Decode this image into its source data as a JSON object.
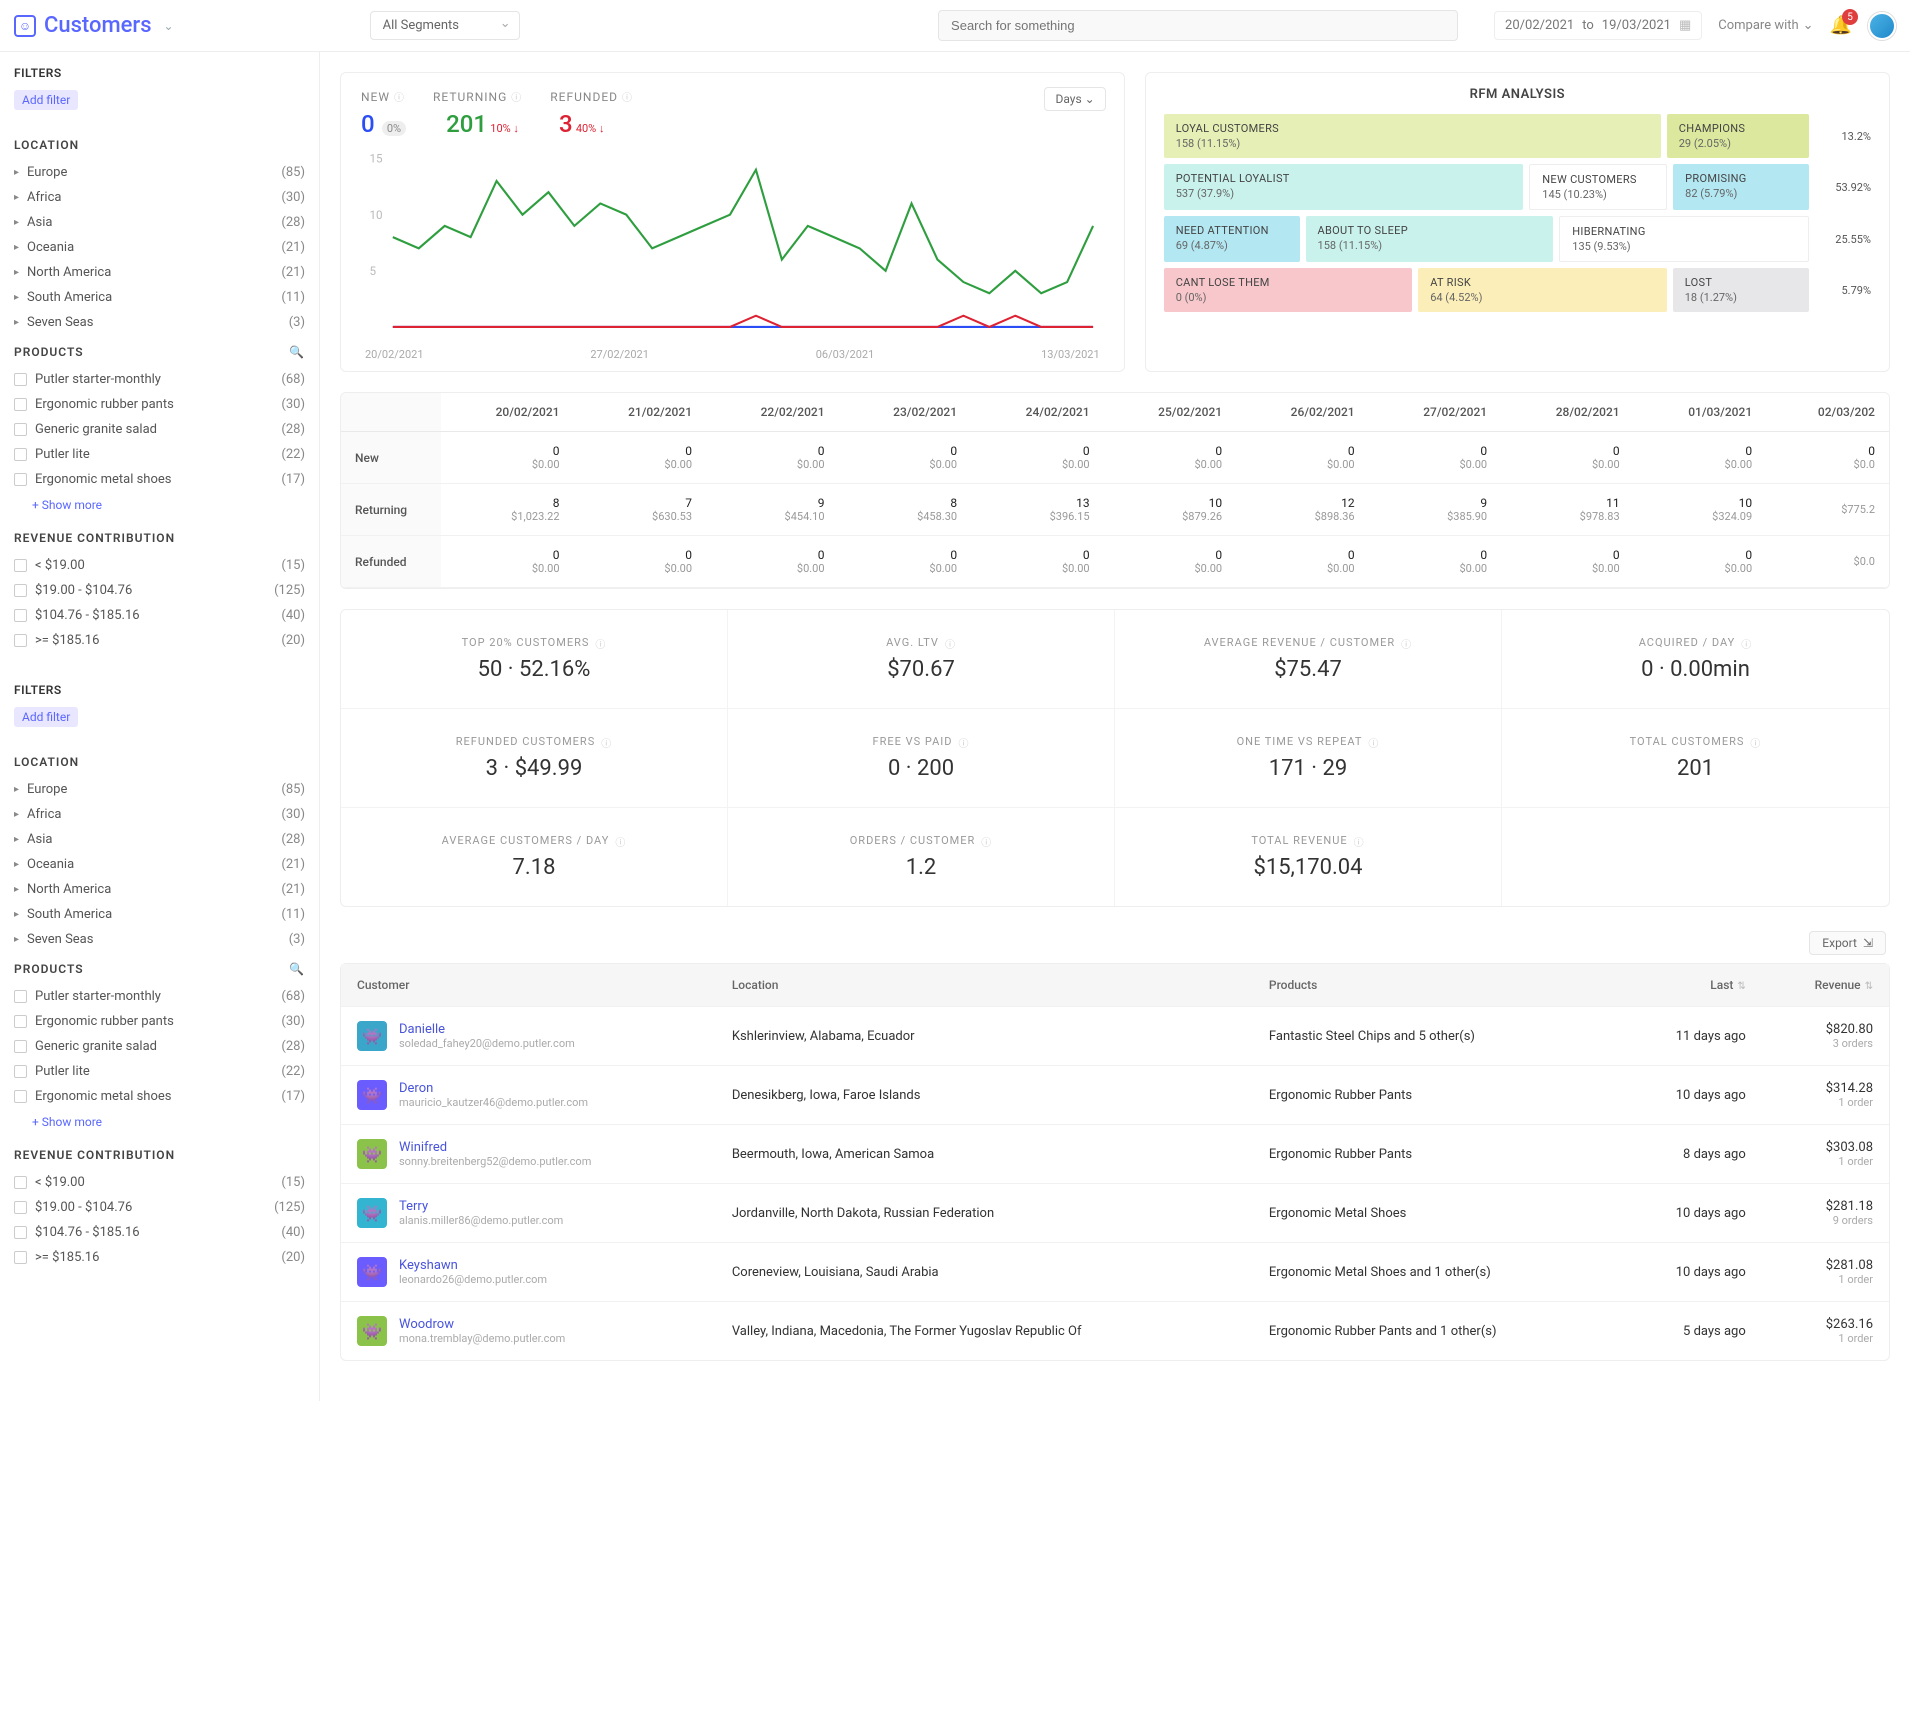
{
  "header": {
    "title": "Customers",
    "segment": "All Segments",
    "search_placeholder": "Search for something",
    "date_from": "20/02/2021",
    "date_to": "19/03/2021",
    "to": "to",
    "compare": "Compare with",
    "notif_count": "5"
  },
  "sidebar": {
    "filters_label": "FILTERS",
    "add_filter": "Add filter",
    "location_label": "LOCATION",
    "products_label": "PRODUCTS",
    "revenue_label": "REVENUE CONTRIBUTION",
    "show_more": "+ Show more",
    "locations": [
      {
        "name": "Europe",
        "count": "85"
      },
      {
        "name": "Africa",
        "count": "30"
      },
      {
        "name": "Asia",
        "count": "28"
      },
      {
        "name": "Oceania",
        "count": "21"
      },
      {
        "name": "North America",
        "count": "21"
      },
      {
        "name": "South America",
        "count": "11"
      },
      {
        "name": "Seven Seas",
        "count": "3"
      }
    ],
    "products": [
      {
        "name": "Putler starter-monthly",
        "count": "68"
      },
      {
        "name": "Ergonomic rubber pants",
        "count": "30"
      },
      {
        "name": "Generic granite salad",
        "count": "28"
      },
      {
        "name": "Putler lite",
        "count": "22"
      },
      {
        "name": "Ergonomic metal shoes",
        "count": "17"
      }
    ],
    "revenue": [
      {
        "name": "< $19.00",
        "count": "15"
      },
      {
        "name": "$19.00 - $104.76",
        "count": "125"
      },
      {
        "name": "$104.76 - $185.16",
        "count": "40"
      },
      {
        "name": ">= $185.16",
        "count": "20"
      }
    ]
  },
  "trend": {
    "tabs": {
      "new": "NEW",
      "returning": "RETURNING",
      "refunded": "REFUNDED"
    },
    "new_val": "0",
    "new_pct": "0%",
    "ret_val": "201",
    "ret_pct": "10% ↓",
    "ref_val": "3",
    "ref_pct": "40% ↓",
    "days": "Days",
    "y_ticks": [
      "15",
      "10",
      "5"
    ],
    "x_ticks": [
      "20/02/2021",
      "27/02/2021",
      "06/03/2021",
      "13/03/2021"
    ]
  },
  "chart_data": {
    "type": "line",
    "title": "",
    "xlabel": "",
    "ylabel": "",
    "ylim": [
      0,
      15
    ],
    "categories": [
      "20/02",
      "21/02",
      "22/02",
      "23/02",
      "24/02",
      "25/02",
      "26/02",
      "27/02",
      "28/02",
      "01/03",
      "02/03",
      "03/03",
      "04/03",
      "05/03",
      "06/03",
      "07/03",
      "08/03",
      "09/03",
      "10/03",
      "11/03",
      "12/03",
      "13/03",
      "14/03",
      "15/03",
      "16/03",
      "17/03",
      "18/03",
      "19/03"
    ],
    "series": [
      {
        "name": "New",
        "color": "#2a4df5",
        "values": [
          0,
          0,
          0,
          0,
          0,
          0,
          0,
          0,
          0,
          0,
          0,
          0,
          0,
          0,
          0,
          0,
          0,
          0,
          0,
          0,
          0,
          0,
          0,
          0,
          0,
          0,
          0,
          0
        ]
      },
      {
        "name": "Returning",
        "color": "#2e9e3f",
        "values": [
          8,
          7,
          9,
          8,
          13,
          10,
          12,
          9,
          11,
          10,
          7,
          8,
          9,
          10,
          14,
          6,
          9,
          8,
          7,
          5,
          11,
          6,
          4,
          3,
          5,
          3,
          4,
          9
        ]
      },
      {
        "name": "Refunded",
        "color": "#d23",
        "values": [
          0,
          0,
          0,
          0,
          0,
          0,
          0,
          0,
          0,
          0,
          0,
          0,
          0,
          0,
          1,
          0,
          0,
          0,
          0,
          0,
          0,
          0,
          1,
          0,
          1,
          0,
          0,
          0
        ]
      }
    ]
  },
  "rfm": {
    "title": "RFM ANALYSIS",
    "rows": [
      {
        "cells": [
          {
            "cls": "c-loyal",
            "t": "LOYAL CUSTOMERS",
            "n": "158 (11.15%)"
          },
          {
            "cls": "c-champ",
            "t": "CHAMPIONS",
            "n": "29 (2.05%)"
          }
        ],
        "pct": "13.2%"
      },
      {
        "cells": [
          {
            "cls": "c-potential",
            "t": "POTENTIAL LOYALIST",
            "n": "537 (37.9%)"
          },
          {
            "cls": "c-newc",
            "t": "NEW CUSTOMERS",
            "n": "145 (10.23%)"
          },
          {
            "cls": "c-prom",
            "t": "PROMISING",
            "n": "82 (5.79%)"
          }
        ],
        "pct": "53.92%"
      },
      {
        "cells": [
          {
            "cls": "c-need",
            "t": "NEED ATTENTION",
            "n": "69 (4.87%)"
          },
          {
            "cls": "c-sleep",
            "t": "ABOUT TO SLEEP",
            "n": "158 (11.15%)"
          },
          {
            "cls": "c-hib",
            "t": "HIBERNATING",
            "n": "135 (9.53%)"
          }
        ],
        "pct": "25.55%"
      },
      {
        "cells": [
          {
            "cls": "c-cant",
            "t": "CANT LOSE THEM",
            "n": "0 (0%)"
          },
          {
            "cls": "c-risk",
            "t": "AT RISK",
            "n": "64 (4.52%)"
          },
          {
            "cls": "c-lost",
            "t": "LOST",
            "n": "18 (1.27%)"
          }
        ],
        "pct": "5.79%"
      }
    ]
  },
  "daily": {
    "dates": [
      "20/02/2021",
      "21/02/2021",
      "22/02/2021",
      "23/02/2021",
      "24/02/2021",
      "25/02/2021",
      "26/02/2021",
      "27/02/2021",
      "28/02/2021",
      "01/03/2021",
      "02/03/202"
    ],
    "rows": [
      {
        "name": "New",
        "cells": [
          [
            "0",
            "$0.00"
          ],
          [
            "0",
            "$0.00"
          ],
          [
            "0",
            "$0.00"
          ],
          [
            "0",
            "$0.00"
          ],
          [
            "0",
            "$0.00"
          ],
          [
            "0",
            "$0.00"
          ],
          [
            "0",
            "$0.00"
          ],
          [
            "0",
            "$0.00"
          ],
          [
            "0",
            "$0.00"
          ],
          [
            "0",
            "$0.00"
          ],
          [
            "0",
            "$0.0"
          ]
        ]
      },
      {
        "name": "Returning",
        "cells": [
          [
            "8",
            "$1,023.22"
          ],
          [
            "7",
            "$630.53"
          ],
          [
            "9",
            "$454.10"
          ],
          [
            "8",
            "$458.30"
          ],
          [
            "13",
            "$396.15"
          ],
          [
            "10",
            "$879.26"
          ],
          [
            "12",
            "$898.36"
          ],
          [
            "9",
            "$385.90"
          ],
          [
            "11",
            "$978.83"
          ],
          [
            "10",
            "$324.09"
          ],
          [
            "",
            "$775.2"
          ]
        ]
      },
      {
        "name": "Refunded",
        "cells": [
          [
            "0",
            "$0.00"
          ],
          [
            "0",
            "$0.00"
          ],
          [
            "0",
            "$0.00"
          ],
          [
            "0",
            "$0.00"
          ],
          [
            "0",
            "$0.00"
          ],
          [
            "0",
            "$0.00"
          ],
          [
            "0",
            "$0.00"
          ],
          [
            "0",
            "$0.00"
          ],
          [
            "0",
            "$0.00"
          ],
          [
            "0",
            "$0.00"
          ],
          [
            "",
            "$0.0"
          ]
        ]
      }
    ]
  },
  "kpis": [
    {
      "lbl": "TOP 20% CUSTOMERS",
      "val": "50 · 52.16%"
    },
    {
      "lbl": "AVG. LTV",
      "val": "$70.67"
    },
    {
      "lbl": "AVERAGE REVENUE / CUSTOMER",
      "val": "$75.47"
    },
    {
      "lbl": "ACQUIRED / DAY",
      "val": "0 · 0.00min"
    },
    {
      "lbl": "REFUNDED CUSTOMERS",
      "val": "3 · $49.99"
    },
    {
      "lbl": "FREE VS PAID",
      "val": "0 · 200"
    },
    {
      "lbl": "ONE TIME VS REPEAT",
      "val": "171 · 29"
    },
    {
      "lbl": "TOTAL CUSTOMERS",
      "val": "201"
    },
    {
      "lbl": "AVERAGE CUSTOMERS / DAY",
      "val": "7.18"
    },
    {
      "lbl": "ORDERS / CUSTOMER",
      "val": "1.2"
    },
    {
      "lbl": "TOTAL REVENUE",
      "val": "$15,170.04"
    }
  ],
  "customers": {
    "export": "Export",
    "cols": {
      "customer": "Customer",
      "location": "Location",
      "products": "Products",
      "last": "Last",
      "revenue": "Revenue"
    },
    "rows": [
      {
        "av": "#3aa6c9",
        "name": "Danielle",
        "email": "soledad_fahey20@demo.putler.com",
        "loc": "Kshlerinview, Alabama, Ecuador",
        "prod": "Fantastic Steel Chips and 5 other(s)",
        "last": "11 days ago",
        "amt": "$820.80",
        "ord": "3 orders"
      },
      {
        "av": "#6a5cff",
        "name": "Deron",
        "email": "mauricio_kautzer46@demo.putler.com",
        "loc": "Denesikberg, Iowa, Faroe Islands",
        "prod": "Ergonomic Rubber Pants",
        "last": "10 days ago",
        "amt": "$314.28",
        "ord": "1 order"
      },
      {
        "av": "#8bc34a",
        "name": "Winifred",
        "email": "sonny.breitenberg52@demo.putler.com",
        "loc": "Beermouth, Iowa, American Samoa",
        "prod": "Ergonomic Rubber Pants",
        "last": "8 days ago",
        "amt": "$303.08",
        "ord": "1 order"
      },
      {
        "av": "#33b5d1",
        "name": "Terry",
        "email": "alanis.miller86@demo.putler.com",
        "loc": "Jordanville, North Dakota, Russian Federation",
        "prod": "Ergonomic Metal Shoes",
        "last": "10 days ago",
        "amt": "$281.18",
        "ord": "9 orders"
      },
      {
        "av": "#6a5cff",
        "name": "Keyshawn",
        "email": "leonardo26@demo.putler.com",
        "loc": "Coreneview, Louisiana, Saudi Arabia",
        "prod": "Ergonomic Metal Shoes and 1 other(s)",
        "last": "10 days ago",
        "amt": "$281.08",
        "ord": "1 order"
      },
      {
        "av": "#8bc34a",
        "name": "Woodrow",
        "email": "mona.tremblay@demo.putler.com",
        "loc": "Valley, Indiana, Macedonia, The Former Yugoslav Republic Of",
        "prod": "Ergonomic Rubber Pants and 1 other(s)",
        "last": "5 days ago",
        "amt": "$263.16",
        "ord": "1 order"
      }
    ]
  }
}
